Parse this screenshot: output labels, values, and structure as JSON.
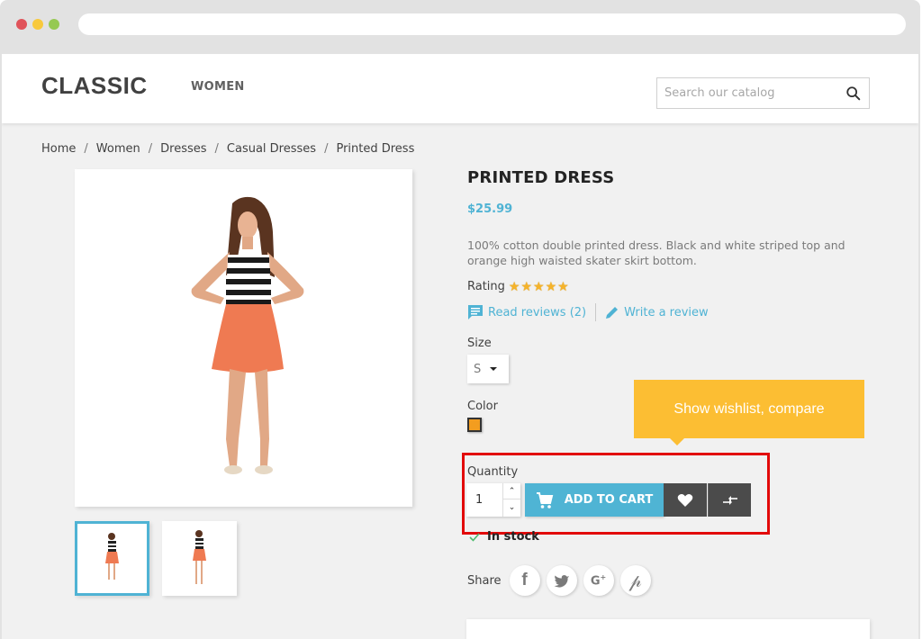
{
  "browser": {
    "dots": [
      "close",
      "minimize",
      "maximize"
    ]
  },
  "header": {
    "logo": "CLASSIC",
    "nav": [
      {
        "label": "WOMEN"
      }
    ],
    "search": {
      "placeholder": "Search our catalog",
      "value": "",
      "icon": "search-icon"
    }
  },
  "breadcrumb": [
    "Home",
    "Women",
    "Dresses",
    "Casual Dresses",
    "Printed Dress"
  ],
  "product": {
    "title": "PRINTED DRESS",
    "price": "$25.99",
    "description": "100% cotton double printed dress. Black and white striped top and orange high waisted skater skirt bottom.",
    "rating_label": "Rating",
    "rating": 5,
    "rating_max": 5,
    "read_reviews": "Read reviews (2)",
    "write_review": "Write a review",
    "size_label": "Size",
    "size_value": "S",
    "color_label": "Color",
    "color_value": "#f39d1f",
    "quantity_label": "Quantity",
    "quantity_value": "1",
    "add_to_cart": "ADD TO CART",
    "stock_status": "In stock",
    "share_label": "Share",
    "share_networks": [
      "facebook",
      "twitter",
      "google-plus",
      "pinterest"
    ],
    "images": [
      "main-product-photo",
      "thumbnail-1",
      "thumbnail-2"
    ]
  },
  "tooltip": {
    "text": "Show wishlist, compare",
    "color": "#fcbe33"
  },
  "colors": {
    "accent": "#4fb4d4",
    "dark_button": "#4b4b4b",
    "highlight": "#e20a0a"
  }
}
